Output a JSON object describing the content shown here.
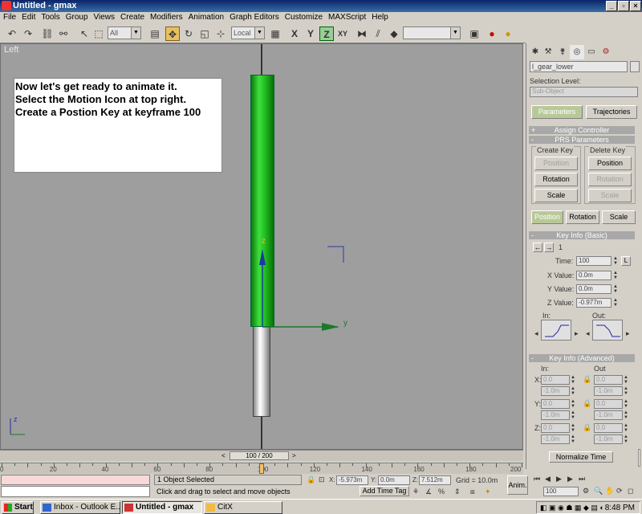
{
  "window": {
    "title": "Untitled - gmax",
    "controls": [
      "_",
      "▫",
      "×"
    ]
  },
  "menu": [
    "File",
    "Edit",
    "Tools",
    "Group",
    "Views",
    "Create",
    "Modifiers",
    "Animation",
    "Graph Editors",
    "Customize",
    "MAXScript",
    "Help"
  ],
  "toolbar": {
    "selection_filter": "All",
    "ref_coord": "Local",
    "axis_z": "Z",
    "axis_xy": "XY"
  },
  "viewport": {
    "label": "Left",
    "note_lines": [
      "Now let's get ready to animate it.",
      "Select the Motion Icon at top right.",
      "Create a Postion Key at keyframe 100"
    ],
    "axis_y_label": "y",
    "axis_z_label": "z",
    "corner_axis_z": "z"
  },
  "colors": {
    "shaft_green": "#22c022",
    "viewport_bg": "#9e9e9e",
    "active_button": "#b8c898"
  },
  "panel": {
    "object_name": "l_gear_lower",
    "selection_level_label": "Selection Level:",
    "sub_object": "Sub-Object",
    "tabs": [
      "Parameters",
      "Trajectories"
    ],
    "assign_controller": "Assign Controller",
    "prs_params": "PRS Parameters",
    "create_key_label": "Create Key",
    "delete_key_label": "Delete Key",
    "create_buttons": [
      "Position",
      "Rotation",
      "Scale"
    ],
    "delete_buttons": [
      "Position",
      "Rotation",
      "Scale"
    ],
    "mode_buttons": [
      "Position",
      "Rotation",
      "Scale"
    ],
    "key_info_basic": "Key Info (Basic)",
    "key_index": "1",
    "time_label": "Time:",
    "time_value": "100",
    "time_lock": "L",
    "xvalue_label": "X Value:",
    "xvalue": "0.0m",
    "yvalue_label": "Y Value:",
    "yvalue": "0.0m",
    "zvalue_label": "Z Value:",
    "zvalue": "-0.977m",
    "in_label": "In:",
    "out_label": "Out:",
    "key_info_adv": "Key Info (Advanced)",
    "adv_in": "In:",
    "adv_out": "Out",
    "adv_rows": [
      {
        "axis": "X:",
        "in1": "0.0",
        "in2": "-1.0m",
        "out1": "0.0",
        "out2": "-1.0m"
      },
      {
        "axis": "Y:",
        "in1": "0.0",
        "in2": "-1.0m",
        "out1": "0.0",
        "out2": "-1.0m"
      },
      {
        "axis": "Z:",
        "in1": "0.0",
        "in2": "-1.0m",
        "out1": "0.0",
        "out2": "-1.0m"
      }
    ],
    "normalize_time": "Normalize Time"
  },
  "timeline": {
    "frame_display": "100 / 200",
    "current_frame": 100,
    "max_frame": 200,
    "ruler_labels": [
      "0",
      "20",
      "40",
      "60",
      "80",
      "100",
      "120",
      "140",
      "160",
      "180",
      "200"
    ]
  },
  "status": {
    "selected": "1 Object Selected",
    "prompt": "Click and drag to select and move objects",
    "x_label": "X:",
    "x": "-5.973m",
    "y_label": "Y:",
    "y": "0.0m",
    "z_label": "Z:",
    "z": "7.512m",
    "grid": "Grid = 10.0m",
    "add_time_tag": "Add Time Tag",
    "anim": "Anim.",
    "frame_field": "100"
  },
  "taskbar": {
    "start": "Start",
    "tasks": [
      "Inbox - Outlook E...",
      "Untitled - gmax",
      "CitX"
    ],
    "clock": "8:48 PM"
  }
}
